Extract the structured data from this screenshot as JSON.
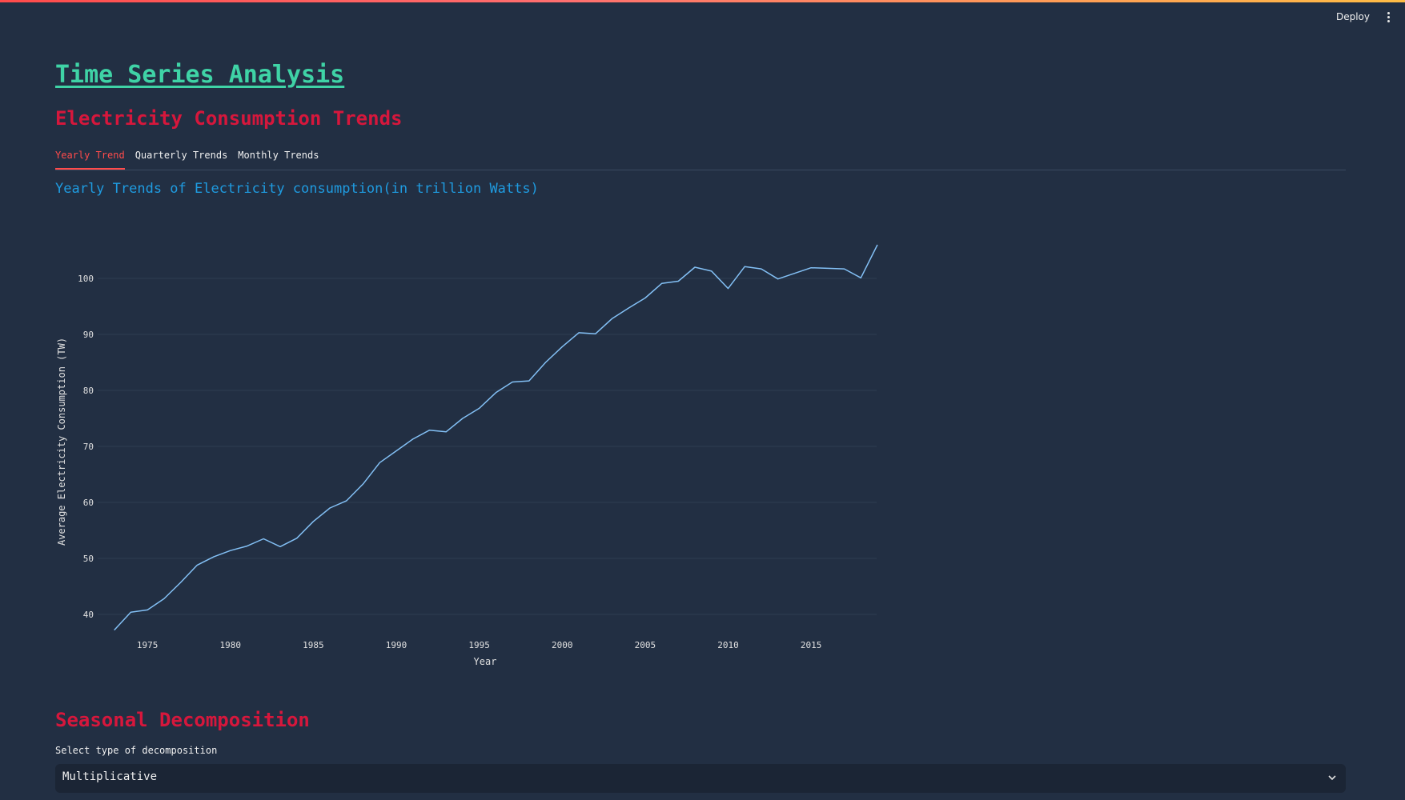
{
  "header": {
    "deploy_label": "Deploy",
    "menu_icon": "kebab-menu-icon"
  },
  "main": {
    "title": "Time Series Analysis",
    "section1_title": "Electricity Consumption Trends",
    "tabs": [
      {
        "label": "Yearly Trend",
        "active": true
      },
      {
        "label": "Quarterly Trends",
        "active": false
      },
      {
        "label": "Monthly Trends",
        "active": false
      }
    ],
    "chart_heading": "Yearly Trends of Electricity consumption(in trillion Watts)",
    "section2_title": "Seasonal Decomposition",
    "decomposition": {
      "label": "Select type of decomposition",
      "selected": "Multiplicative",
      "icon": "chevron-down-icon"
    }
  },
  "colors": {
    "background": "#222f43",
    "title": "#3fd3a6",
    "section_title": "#d6173c",
    "chart_heading": "#1f9be0",
    "active_tab": "#ff4b4b",
    "line": "#83c0f5"
  },
  "chart_data": {
    "type": "line",
    "xlabel": "Year",
    "ylabel": "Average Electricity Consumption (TW)",
    "xlim": [
      1972,
      2019
    ],
    "ylim": [
      38,
      106
    ],
    "grid": true,
    "x_ticks": [
      1975,
      1980,
      1985,
      1990,
      1995,
      2000,
      2005,
      2010,
      2015
    ],
    "y_ticks": [
      40,
      50,
      60,
      70,
      80,
      90,
      100
    ],
    "series": [
      {
        "x": [
          1973,
          1974,
          1975,
          1976,
          1977,
          1978,
          1979,
          1980,
          1981,
          1982,
          1983,
          1984,
          1985,
          1986,
          1987,
          1988,
          1989,
          1990,
          1991,
          1992,
          1993,
          1994,
          1995,
          1996,
          1997,
          1998,
          1999,
          2000,
          2001,
          2002,
          2003,
          2004,
          2005,
          2006,
          2007,
          2008,
          2009,
          2010,
          2011,
          2012,
          2013,
          2014,
          2015,
          2016,
          2017,
          2018,
          2019
        ],
        "y": [
          37.2,
          40.4,
          40.8,
          42.8,
          45.7,
          48.8,
          50.3,
          51.4,
          52.2,
          53.5,
          52.1,
          53.6,
          56.6,
          59.0,
          60.3,
          63.3,
          67.1,
          69.2,
          71.3,
          72.9,
          72.6,
          75.0,
          76.8,
          79.6,
          81.5,
          81.7,
          85.0,
          87.8,
          90.3,
          90.1,
          92.8,
          94.7,
          96.5,
          99.1,
          99.5,
          102.0,
          101.3,
          98.2,
          102.1,
          101.7,
          99.9,
          100.9,
          101.9,
          101.8,
          101.7,
          100.1,
          106.0
        ]
      }
    ]
  }
}
